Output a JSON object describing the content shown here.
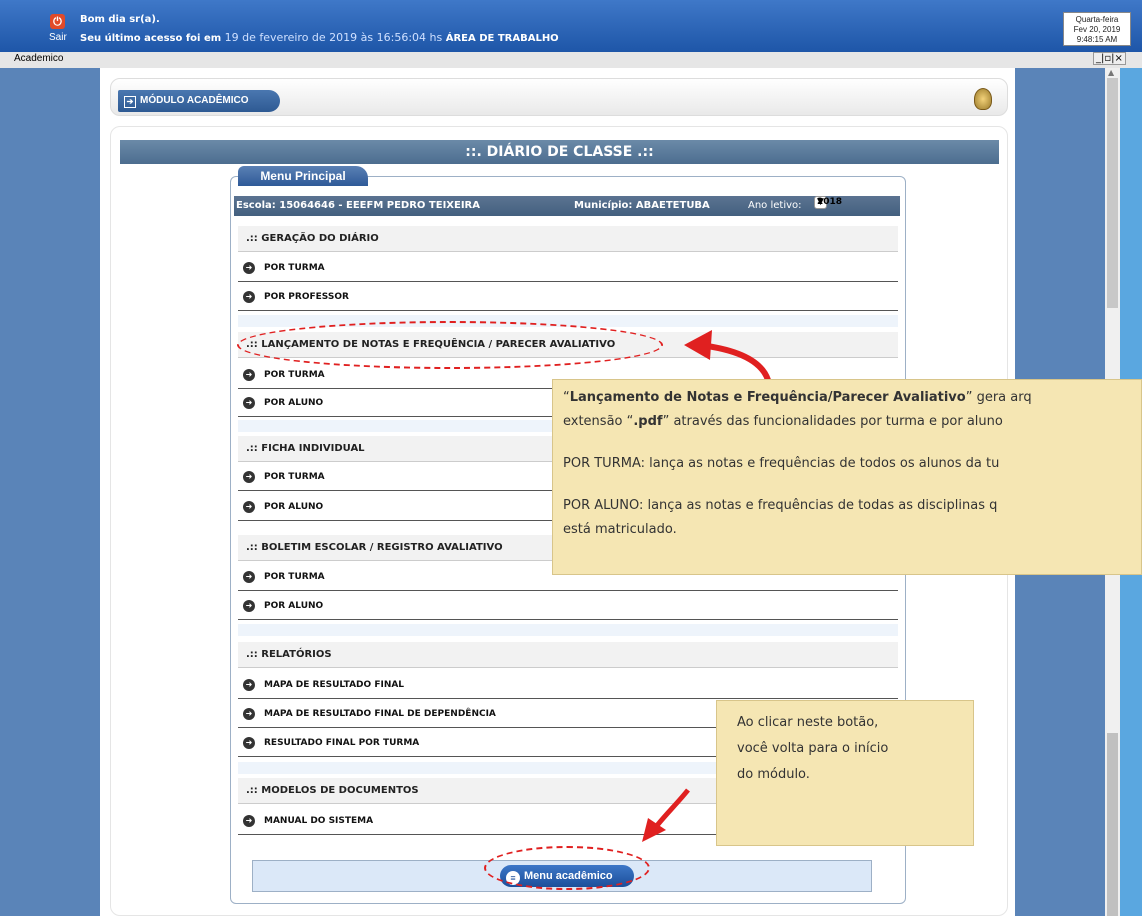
{
  "topbar": {
    "logout_label": "Sair",
    "greeting": "Bom dia sr(a).",
    "last_access_prefix": "Seu último acesso foi em",
    "last_access_date": "19 de fevereiro de 2019 às 16:56:04 hs",
    "area": "ÁREA DE TRABALHO",
    "clock": {
      "weekday": "Quarta-feira",
      "date": "Fev 20, 2019",
      "time": "9:48:15 AM"
    }
  },
  "window": {
    "title": "Academico",
    "controls": "_|▫|×"
  },
  "module": {
    "button_label": "MÓDULO ACADÊMICO"
  },
  "page_title": "::. DIÁRIO DE CLASSE .::",
  "menu": {
    "tab_label": "Menu Principal",
    "info": {
      "escola": "Escola: 15064646 - EEEFM PEDRO TEIXEIRA",
      "municipio": "Município: ABAETETUBA",
      "ano_label": "Ano letivo:",
      "ano_value": "2018"
    },
    "sections": {
      "geracao": {
        "title": ".:: GERAÇÃO DO DIÁRIO",
        "items": [
          "POR TURMA",
          "POR PROFESSOR"
        ]
      },
      "lancamento": {
        "title": ".:: LANÇAMENTO DE NOTAS E FREQUÊNCIA / PARECER AVALIATIVO",
        "items": [
          "POR TURMA",
          "POR ALUNO"
        ]
      },
      "ficha": {
        "title": ".:: FICHA INDIVIDUAL",
        "items": [
          "POR TURMA",
          "POR ALUNO"
        ]
      },
      "boletim": {
        "title": ".:: BOLETIM ESCOLAR / REGISTRO AVALIATIVO",
        "items": [
          "POR TURMA",
          "POR ALUNO"
        ]
      },
      "relatorios": {
        "title": ".:: RELATÓRIOS",
        "items": [
          "MAPA DE RESULTADO FINAL",
          "MAPA DE RESULTADO FINAL DE DEPENDÊNCIA",
          "RESULTADO FINAL POR TURMA"
        ]
      },
      "modelos": {
        "title": ".:: MODELOS DE DOCUMENTOS",
        "items": [
          "MANUAL DO SISTEMA"
        ]
      }
    },
    "bottom_button": "Menu acadêmico"
  },
  "callouts": {
    "first": {
      "line1_q1": "“",
      "line1_bold": "Lançamento de Notas e Frequência/Parecer Avaliativo",
      "line1_rest": "” gera arq",
      "line2_a": "extensão “",
      "line2_bold": ".pdf",
      "line2_rest": "” através das funcionalidades por turma e por aluno",
      "line3": "POR TURMA: lança as notas e frequências de todos os alunos da tu",
      "line4": "POR ALUNO: lança as notas e frequências de todas as disciplinas q",
      "line5": "está matriculado."
    },
    "second": {
      "line1": "Ao clicar neste botão,",
      "line2": "você volta para o início",
      "line3": "do módulo."
    }
  },
  "colors": {
    "annotation_red": "#e02020",
    "callout_bg": "#f5e6b3",
    "header_blue": "#1e56a8"
  },
  "icons": [
    "power-icon",
    "arrow-right-circle-icon",
    "module-enter-icon",
    "crest-icon",
    "menu-list-icon"
  ]
}
